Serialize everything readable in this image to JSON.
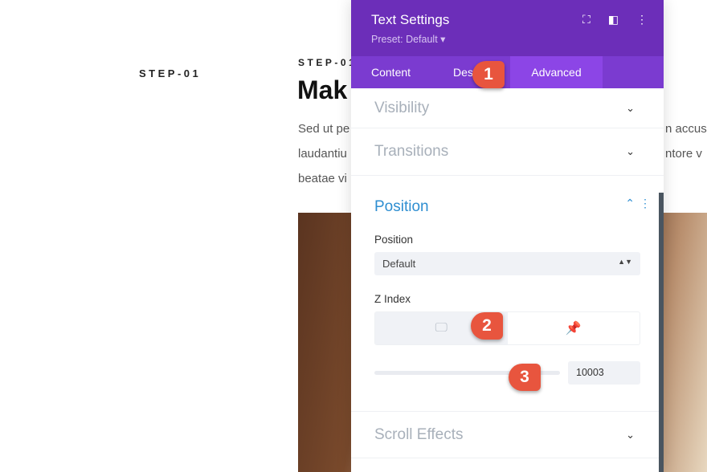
{
  "page": {
    "step_left": "STEP-01",
    "step_mid": "STEP-01",
    "heading": "Mak",
    "para_left": [
      "Sed ut pe",
      "laudantiu",
      "beatae vi"
    ],
    "para_right": [
      "n accus",
      "ntore v"
    ]
  },
  "panel": {
    "title": "Text Settings",
    "preset": "Preset: Default ▾",
    "icons": [
      "fullscreen-icon",
      "split-view-icon",
      "more-icon"
    ],
    "tabs": [
      "Content",
      "Des",
      "Advanced"
    ],
    "sections": {
      "visibility": "Visibility",
      "transitions": "Transitions",
      "position": "Position",
      "scroll_effects": "Scroll Effects"
    },
    "position_label": "Position",
    "position_value": "Default",
    "z_index_label": "Z Index",
    "z_index_value": "10003",
    "accent": "#2e8ed1",
    "header_color": "#6c2eb9"
  },
  "annotations": [
    "1",
    "2",
    "3"
  ]
}
